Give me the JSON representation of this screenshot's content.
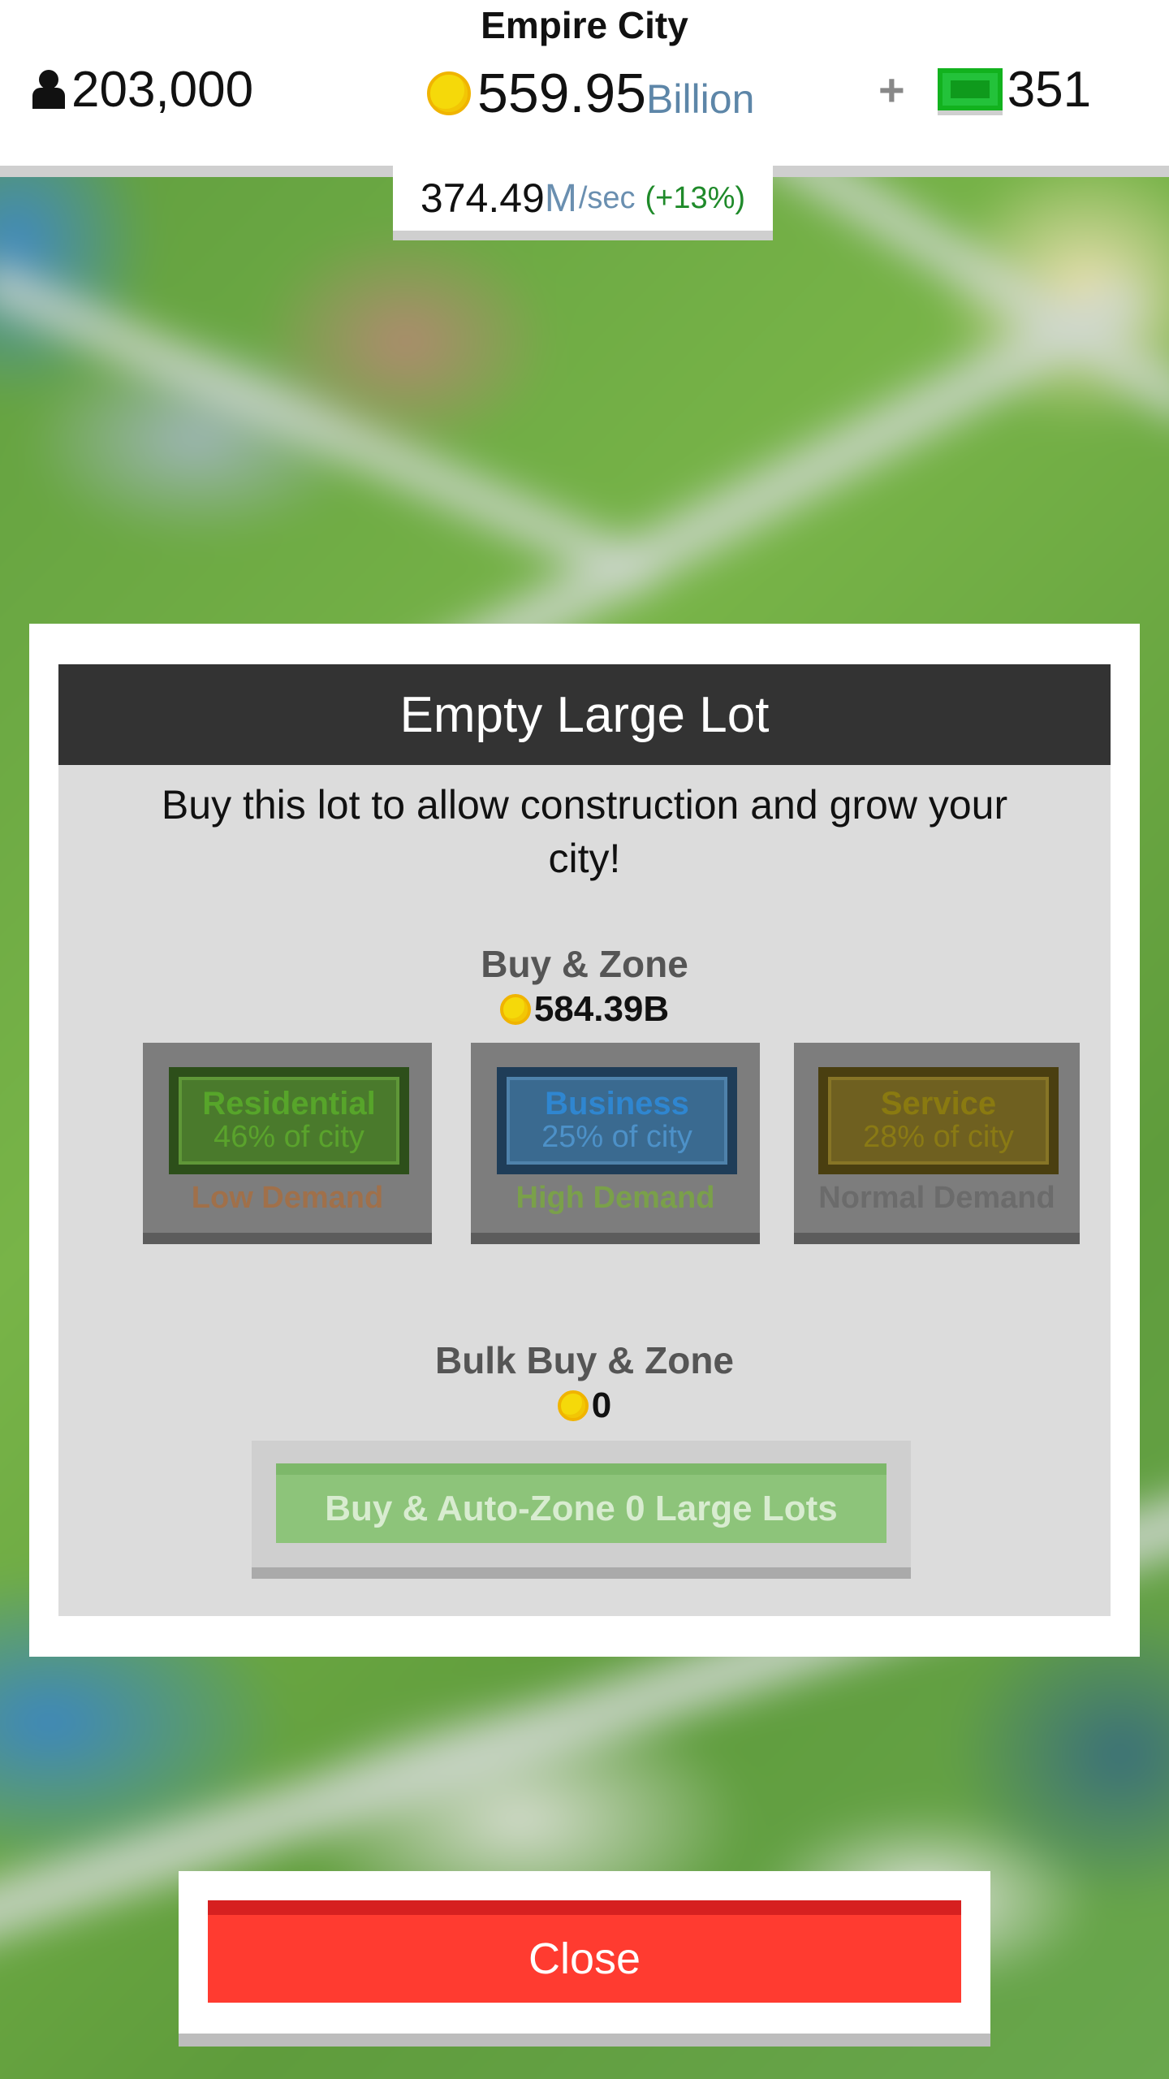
{
  "header": {
    "city_name": "Empire City",
    "population": "203,000",
    "money_amount": "559.95",
    "money_unit": "Billion",
    "cash_plus": "+",
    "cash_count": "351",
    "rate_value": "374.49",
    "rate_unit": "M",
    "rate_per": "/sec",
    "rate_change": "(+13%)"
  },
  "dialog": {
    "title": "Empty Large Lot",
    "description": "Buy this lot to allow construction and grow your city!",
    "buy_zone_title": "Buy & Zone",
    "buy_zone_price": "584.39B",
    "zones": [
      {
        "name": "Residential",
        "share": "46% of city",
        "demand": "Low Demand"
      },
      {
        "name": "Business",
        "share": "25% of city",
        "demand": "High Demand"
      },
      {
        "name": "Service",
        "share": "28% of city",
        "demand": "Normal Demand"
      }
    ],
    "bulk_title": "Bulk Buy & Zone",
    "bulk_price": "0",
    "bulk_button": "Buy & Auto-Zone 0 Large Lots"
  },
  "footer": {
    "close_label": "Close"
  },
  "colors": {
    "close_button": "#ff3b30",
    "header_bar": "#333333",
    "residential": "#57a52a",
    "business": "#2f86d0",
    "service": "#8a7a10"
  },
  "icons": {
    "population": "person-icon",
    "money": "coin-icon",
    "cash": "cash-bill-icon"
  }
}
